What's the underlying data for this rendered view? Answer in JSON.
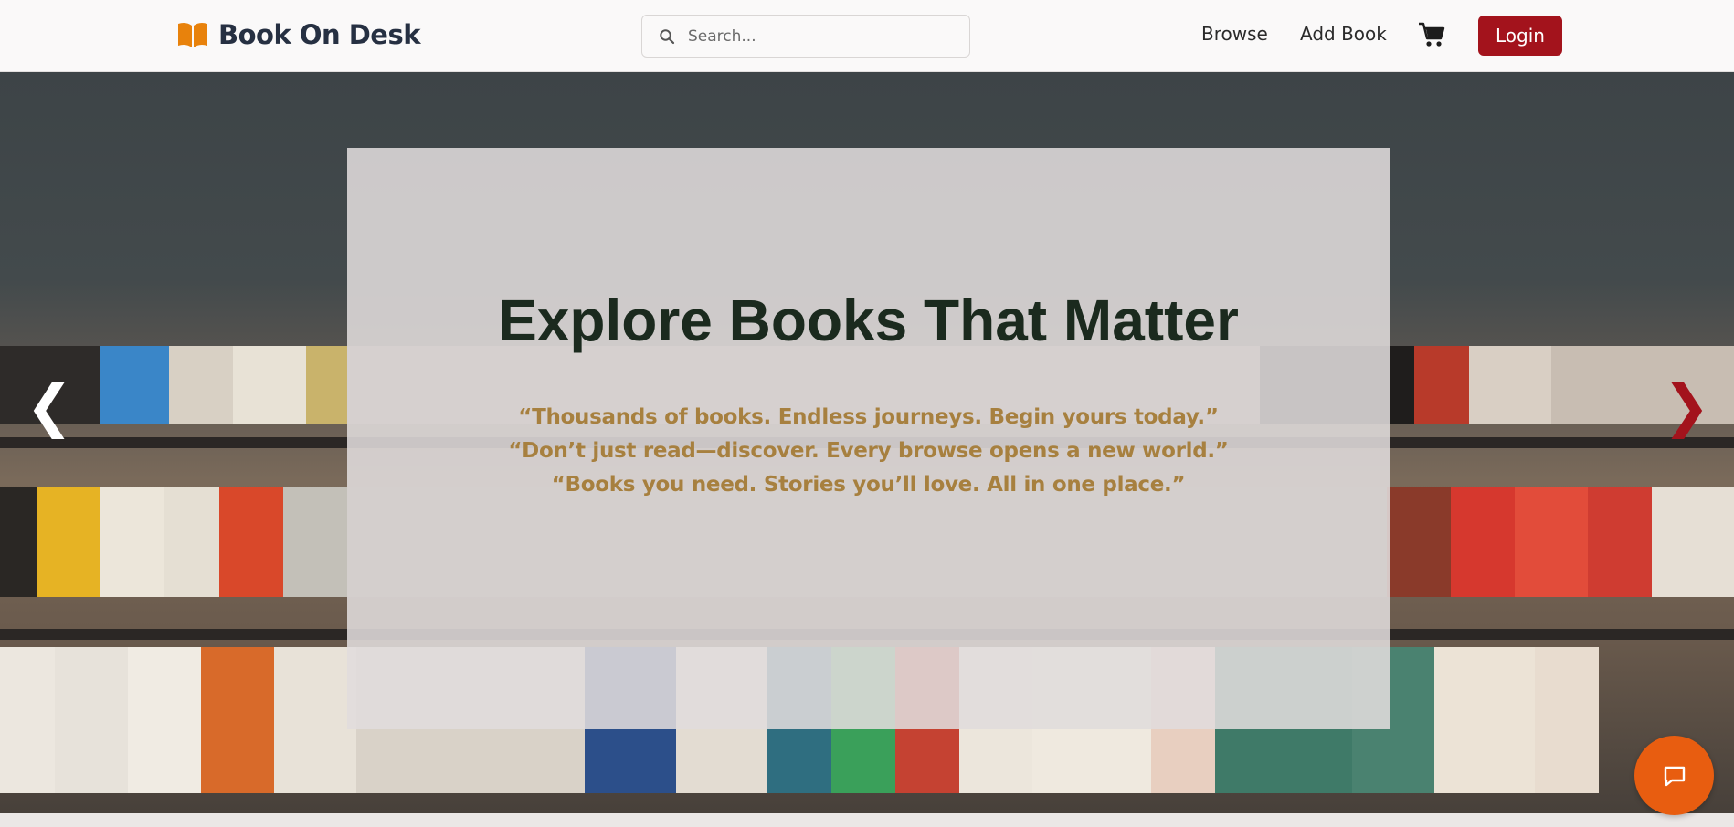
{
  "header": {
    "brand": "Book On Desk",
    "search_placeholder": "Search...",
    "nav": {
      "browse": "Browse",
      "add_book": "Add Book"
    },
    "login": "Login"
  },
  "hero": {
    "title": "Explore Books That Matter",
    "quotes": [
      "“Thousands of books. Endless journeys. Begin yours today.”",
      "“Don’t just read—discover. Every browse opens a new world.”",
      "“Books you need. Stories you’ll love. All in one place.”"
    ],
    "prev_arrow": "❮",
    "next_arrow": "❯"
  },
  "icons": {
    "logo": "book-open-icon",
    "search": "search-icon",
    "cart": "cart-icon",
    "chat": "chat-icon"
  },
  "colors": {
    "accent": "#a3131c",
    "brand_orange": "#e8820c",
    "chat": "#e85d10",
    "quote": "#a7803f",
    "title": "#1b2a1e"
  }
}
